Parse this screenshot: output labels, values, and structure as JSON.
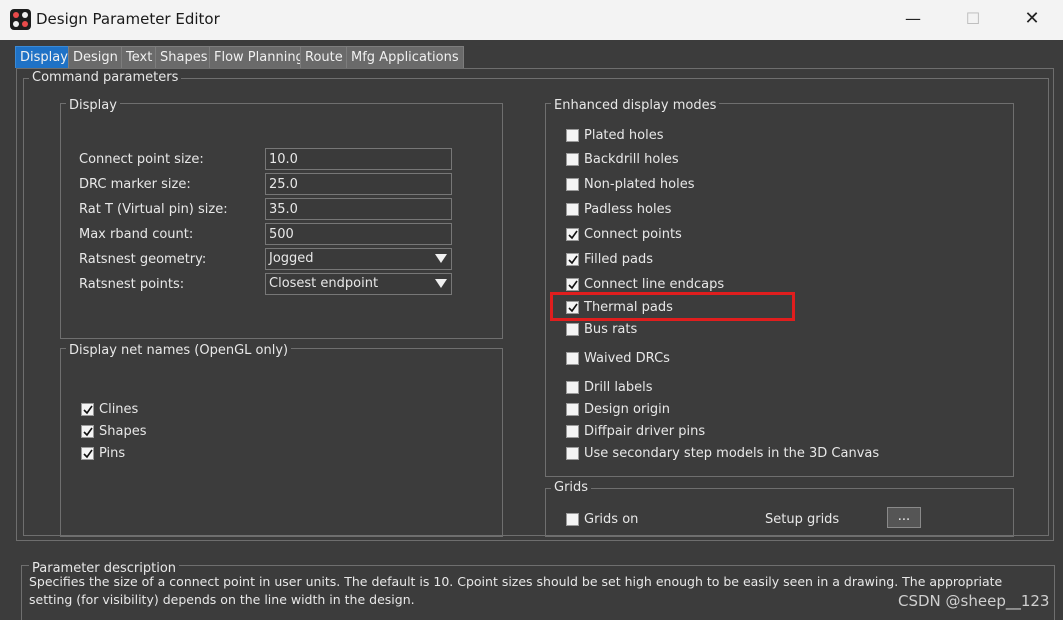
{
  "window": {
    "title": "Design Parameter Editor"
  },
  "tabs": [
    "Display",
    "Design",
    "Text",
    "Shapes",
    "Flow Planning",
    "Route",
    "Mfg Applications"
  ],
  "command_parameters": {
    "legend": "Command parameters"
  },
  "display_group": {
    "legend": "Display",
    "connect_point_size": {
      "label": "Connect point size:",
      "value": "10.0"
    },
    "drc_marker_size": {
      "label": "DRC marker size:",
      "value": "25.0"
    },
    "rat_t_size": {
      "label": "Rat T (Virtual pin) size:",
      "value": "35.0"
    },
    "max_rband_count": {
      "label": "Max rband count:",
      "value": "500"
    },
    "ratsnest_geometry": {
      "label": "Ratsnest geometry:",
      "value": "Jogged"
    },
    "ratsnest_points": {
      "label": "Ratsnest points:",
      "value": "Closest endpoint"
    }
  },
  "net_names_group": {
    "legend": "Display net names (OpenGL only)",
    "items": [
      {
        "label": "Clines",
        "checked": true
      },
      {
        "label": "Shapes",
        "checked": true
      },
      {
        "label": "Pins",
        "checked": true
      }
    ]
  },
  "enhanced_group": {
    "legend": "Enhanced display modes",
    "items": [
      {
        "label": "Plated holes",
        "checked": false
      },
      {
        "label": "Backdrill holes",
        "checked": false
      },
      {
        "label": "Non-plated holes",
        "checked": false
      },
      {
        "label": "Padless holes",
        "checked": false
      },
      {
        "label": "Connect points",
        "checked": true
      },
      {
        "label": "Filled pads",
        "checked": true
      },
      {
        "label": "Connect line endcaps",
        "checked": true
      },
      {
        "label": "Thermal pads",
        "checked": true
      },
      {
        "label": "Bus rats",
        "checked": false
      },
      {
        "label": "Waived DRCs",
        "checked": false
      },
      {
        "label": "Drill labels",
        "checked": false
      },
      {
        "label": "Design origin",
        "checked": false
      },
      {
        "label": "Diffpair driver pins",
        "checked": false
      },
      {
        "label": "Use secondary step models in the 3D Canvas",
        "checked": false
      }
    ]
  },
  "grids_group": {
    "legend": "Grids",
    "grids_on": {
      "label": "Grids on",
      "checked": false
    },
    "setup_label": "Setup grids",
    "setup_button": "..."
  },
  "parameter_description": {
    "legend": "Parameter description",
    "text": "Specifies the size of a connect point in user units. The default is 10. Cpoint sizes should be set high enough to be easily seen in a drawing. The appropriate setting (for visibility) depends on the line width in the design."
  },
  "watermark": "CSDN @sheep__123",
  "colors": {
    "active_tab": "#1f72c6",
    "highlight": "#e01e1e",
    "background": "#3c3c3c"
  }
}
